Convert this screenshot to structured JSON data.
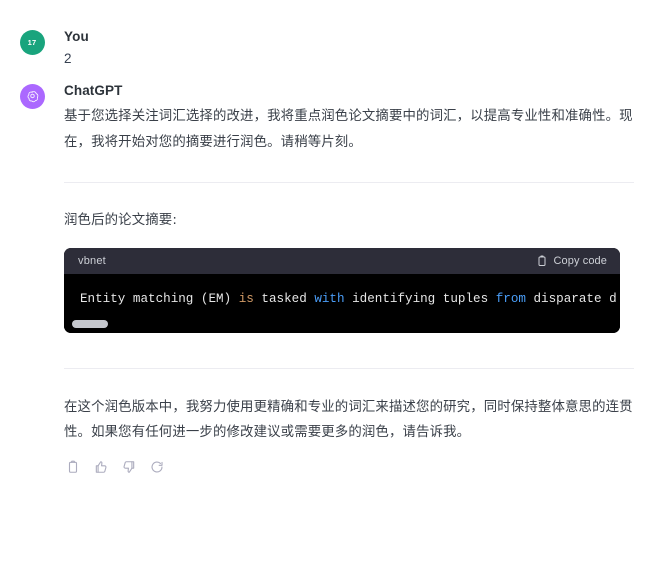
{
  "conversation": {
    "turns": [
      {
        "id": "user-turn",
        "author": "You",
        "avatar_text": "17",
        "avatar_color": "#19a47d",
        "avatar_icon": "user-initials-avatar",
        "message": "2"
      },
      {
        "id": "assistant-turn",
        "author": "ChatGPT",
        "avatar_color": "#ab68ff",
        "avatar_icon": "openai-logo-icon",
        "paragraph_intro": "基于您选择关注词汇选择的改进，我将重点润色论文摘要中的词汇，以提高专业性和准确性。现在，我将开始对您的摘要进行润色。请稍等片刻。",
        "section_label": "润色后的论文摘要:",
        "paragraph_closing": "在这个润色版本中，我努力使用更精确和专业的词汇来描述您的研究，同时保持整体意思的连贯性。如果您有任何进一步的修改建议或需要更多的润色，请告诉我。"
      }
    ]
  },
  "code_block": {
    "language": "vbnet",
    "copy_label": "Copy code",
    "copy_icon": "clipboard-icon",
    "tokens": [
      {
        "text": "Entity matching (EM) ",
        "type": "plain"
      },
      {
        "text": "is",
        "type": "keyword-orange"
      },
      {
        "text": " tasked ",
        "type": "plain"
      },
      {
        "text": "with",
        "type": "keyword-blue"
      },
      {
        "text": " identifying tuples ",
        "type": "plain"
      },
      {
        "text": "from",
        "type": "keyword-blue"
      },
      {
        "text": " disparate d",
        "type": "plain"
      }
    ],
    "colors": {
      "header_bg": "#2d2d39",
      "body_bg": "#000000",
      "plain_text": "#e6e6e6",
      "keyword_orange": "#d19a66",
      "keyword_blue": "#4a9df7",
      "scrollbar_thumb": "#c5c7cd"
    }
  },
  "actions": [
    {
      "name": "copy-message-button",
      "icon": "clipboard-icon",
      "label": "Copy"
    },
    {
      "name": "thumbs-up-button",
      "icon": "thumbs-up-icon",
      "label": "Good response"
    },
    {
      "name": "thumbs-down-button",
      "icon": "thumbs-down-icon",
      "label": "Bad response"
    },
    {
      "name": "regenerate-button",
      "icon": "refresh-icon",
      "label": "Regenerate"
    }
  ],
  "theme": {
    "background": "#ffffff",
    "text": "#374151",
    "divider": "#ececf1",
    "icon_muted": "#acacbe"
  }
}
